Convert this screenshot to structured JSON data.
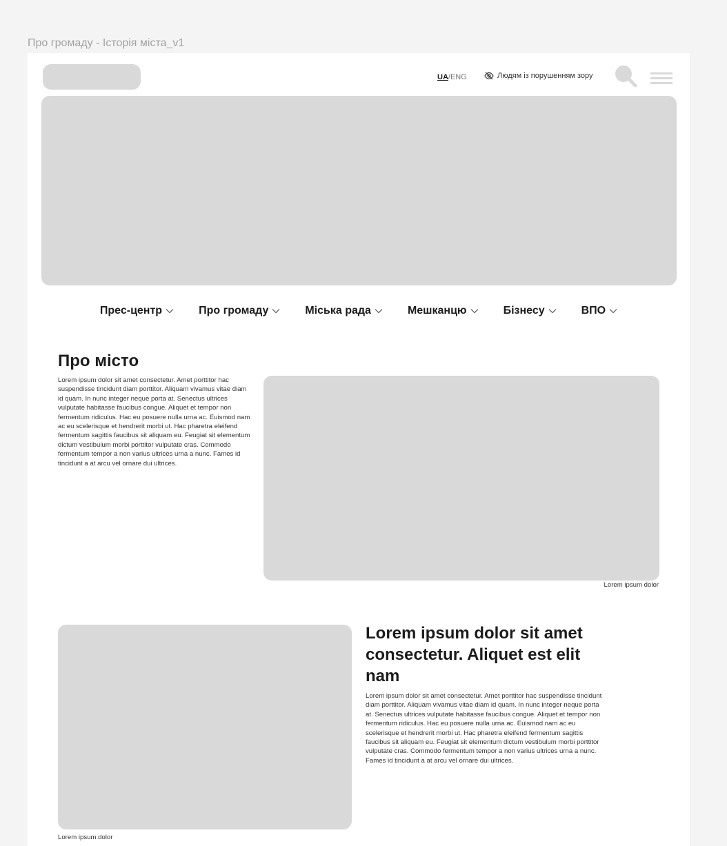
{
  "frame": {
    "title": "Про громаду - Історія міста_v1"
  },
  "header": {
    "lang_active": "UA",
    "lang_separator": "/",
    "lang_other": "ENG",
    "accessibility_label": "Людям із порушенням зору",
    "icons": {
      "accessibility": "eye-slash-icon",
      "search": "search-icon",
      "menu": "hamburger-menu-icon"
    }
  },
  "nav": {
    "items": [
      {
        "label": "Прес-центр"
      },
      {
        "label": "Про громаду"
      },
      {
        "label": "Міська рада"
      },
      {
        "label": "Мешканцю"
      },
      {
        "label": "Бізнесу"
      },
      {
        "label": "ВПО"
      }
    ]
  },
  "about": {
    "title": "Про місто",
    "text": "Lorem ipsum dolor sit amet consectetur. Amet porttitor hac suspendisse tincidunt diam porttitor. Aliquam vivamus vitae diam id quam. In nunc integer neque porta at. Senectus ultrices vulputate habitasse faucibus congue. Aliquet et tempor non fermentum ridiculus. Hac eu posuere nulla urna ac. Euismod nam ac eu scelerisque et hendrerit morbi ut. Hac pharetra eleifend fermentum sagittis faucibus sit aliquam eu. Feugiat sit elementum dictum vestibulum morbi porttitor vulputate cras. Commodo fermentum tempor a non varius ultrices urna a nunc. Fames id tincidunt a at arcu vel ornare dui ultrices.",
    "image_caption": "Lorem ipsum dolor"
  },
  "article": {
    "title": "Lorem ipsum dolor sit amet consectetur. Aliquet est elit nam",
    "text": "Lorem ipsum dolor sit amet consectetur. Amet porttitor hac suspendisse tincidunt diam porttitor. Aliquam vivamus vitae diam id quam. In nunc integer neque porta at. Senectus ultrices vulputate habitasse faucibus congue. Aliquet et tempor non fermentum ridiculus. Hac eu posuere nulla urna ac. Euismod nam ac eu scelerisque et hendrerit morbi ut. Hac pharetra eleifend fermentum sagittis faucibus sit aliquam eu. Feugiat sit elementum dictum vestibulum morbi porttitor vulputate cras. Commodo fermentum tempor a non varius ultrices urna a nunc. Fames id tincidunt a at arcu vel ornare dui ultrices.",
    "image_caption": "Lorem ipsum dolor"
  },
  "colors": {
    "page_background": "#f4f4f4",
    "canvas_background": "#ffffff",
    "placeholder": "#d9d9d9",
    "text_primary": "#1c1c1c",
    "frame_title": "#a2a2a2"
  }
}
